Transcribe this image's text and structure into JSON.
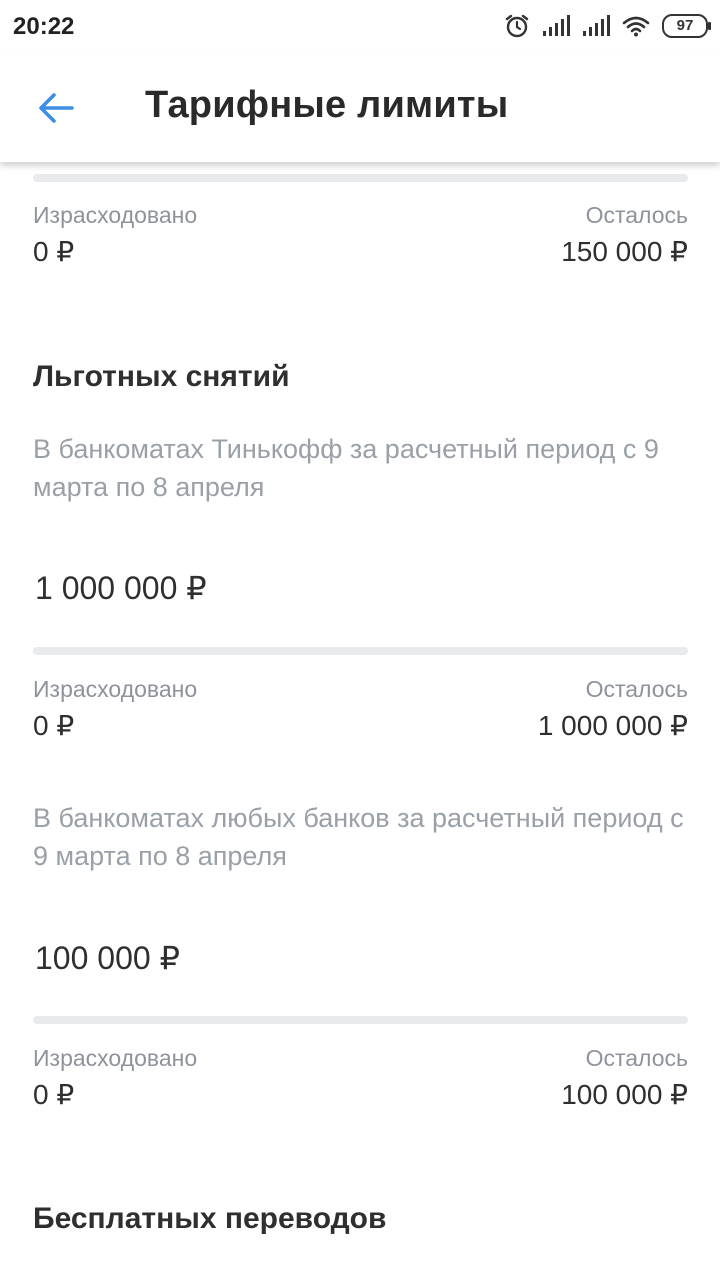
{
  "status": {
    "time": "20:22",
    "battery": "97"
  },
  "header": {
    "title": "Тарифные лимиты"
  },
  "blocks": [
    {
      "spent_label": "Израсходовано",
      "spent": "0 ₽",
      "left_label": "Осталось",
      "left": "150 000 ₽"
    }
  ],
  "sections": [
    {
      "title": "Льготных снятий",
      "items": [
        {
          "desc": "В банкоматах Тинькофф за расчетный период с 9 марта по 8 апреля",
          "limit": "1 000 000 ₽",
          "spent_label": "Израсходовано",
          "spent": "0 ₽",
          "left_label": "Осталось",
          "left": "1 000 000 ₽"
        },
        {
          "desc": "В банкоматах любых банков за расчетный период с 9 марта по 8 апреля",
          "limit": "100 000 ₽",
          "spent_label": "Израсходовано",
          "spent": "0 ₽",
          "left_label": "Осталось",
          "left": "100 000 ₽"
        }
      ]
    },
    {
      "title": "Бесплатных переводов"
    }
  ],
  "colors": {
    "accent": "#3d8ee6",
    "muted": "#8e939b",
    "track": "#e8eaee"
  }
}
